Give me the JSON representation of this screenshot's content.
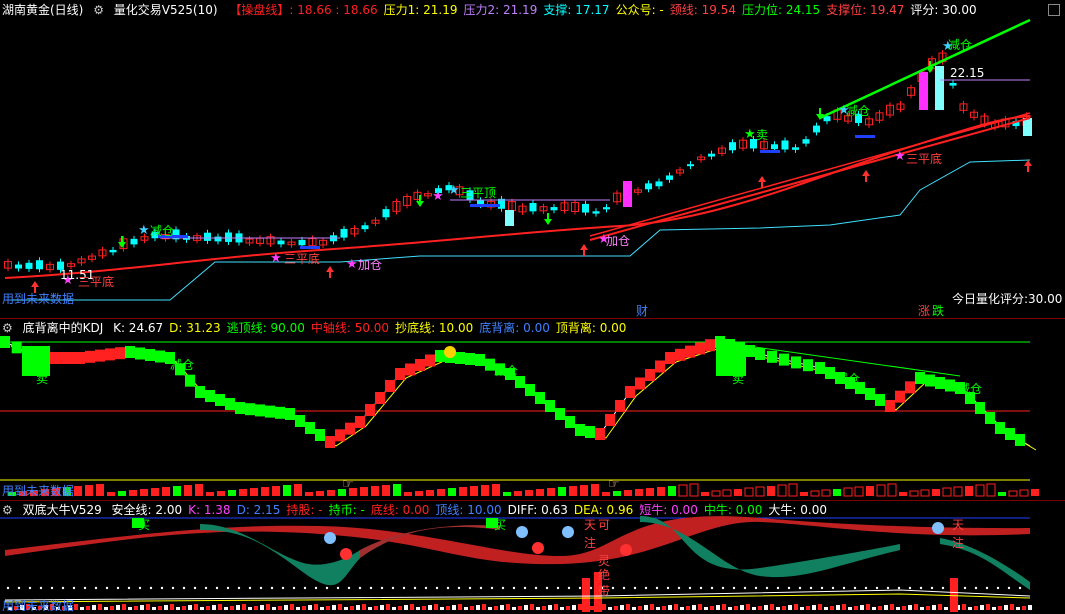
{
  "panel1": {
    "instrument": "湖南黄金(日线)",
    "indicator": "量化交易V525(10)",
    "items": [
      {
        "label": "【操盘线】: 18.66 : 18.66",
        "color": "#ff2020"
      },
      {
        "label": "压力1: 21.19",
        "color": "#ffff00"
      },
      {
        "label": "压力2: 21.19",
        "color": "#c080ff"
      },
      {
        "label": "支撑: 17.17",
        "color": "#00ffff"
      },
      {
        "label": "公众号: -",
        "color": "#ffff00"
      },
      {
        "label": "颈线: 19.54",
        "color": "#ff4040"
      },
      {
        "label": "压力位: 24.15",
        "color": "#00ff00"
      },
      {
        "label": "支撑位: 19.47",
        "color": "#ff4040"
      },
      {
        "label": "评分: 30.00",
        "color": "#ffffff"
      }
    ],
    "price_label": "22.15",
    "low_label": "11.51",
    "score_text": "今日量化评分:30.00",
    "future_text": "用到未来数据",
    "cai_label": "财",
    "zhang_label": "涨",
    "die_label": "跌",
    "signals": {
      "jian": "减仓",
      "mai": "卖",
      "sanpingding": "三平顶",
      "sanpingdi": "三平底",
      "jiacang": "加仓"
    }
  },
  "panel2": {
    "title": "底背离中的KDJ",
    "items": [
      {
        "label": "K: 24.67",
        "color": "#ffffff"
      },
      {
        "label": "D: 31.23",
        "color": "#ffff00"
      },
      {
        "label": "逃顶线: 90.00",
        "color": "#00ff00"
      },
      {
        "label": "中轴线: 50.00",
        "color": "#ff2020"
      },
      {
        "label": "抄底线: 10.00",
        "color": "#ffff00"
      },
      {
        "label": "底背离: 0.00",
        "color": "#4080ff"
      },
      {
        "label": "顶背离: 0.00",
        "color": "#ffff00"
      }
    ],
    "future_text": "用到未来数据",
    "labels": {
      "mai": "卖",
      "jian": "减仓"
    }
  },
  "panel3": {
    "title": "双底大牛V529",
    "items": [
      {
        "label": "安全线: 2.00",
        "color": "#ffffff"
      },
      {
        "label": "K: 1.38",
        "color": "#ff40ff"
      },
      {
        "label": "D: 2.15",
        "color": "#4080ff"
      },
      {
        "label": "持股: -",
        "color": "#ff2020"
      },
      {
        "label": "持币: -",
        "color": "#00ff00"
      },
      {
        "label": "底线: 0.00",
        "color": "#ff2020"
      },
      {
        "label": "顶线: 10.00",
        "color": "#4080ff"
      },
      {
        "label": "DIFF: 0.63",
        "color": "#ffffff"
      },
      {
        "label": "DEA: 0.96",
        "color": "#ffff00"
      },
      {
        "label": "短牛: 0.00",
        "color": "#ff40ff"
      },
      {
        "label": "中牛: 0.00",
        "color": "#00ff00"
      },
      {
        "label": "大牛: 0.00",
        "color": "#ffffff"
      }
    ],
    "future_text": "用到未来数据",
    "labels": {
      "tian1": "天",
      "ke": "可",
      "zhu1": "注",
      "tian2": "天",
      "zhu2": "注",
      "mai3": "买",
      "ling": "灵",
      "jue": "绝",
      "dai": "带",
      "ma": "马",
      "niu": "牛"
    }
  },
  "colors": {
    "up": "#ff2020",
    "down": "#00ffff",
    "sep": "#7d0000",
    "ma_red": "#ff2020",
    "ma_green": "#00ff00",
    "support": "#00ffff"
  }
}
